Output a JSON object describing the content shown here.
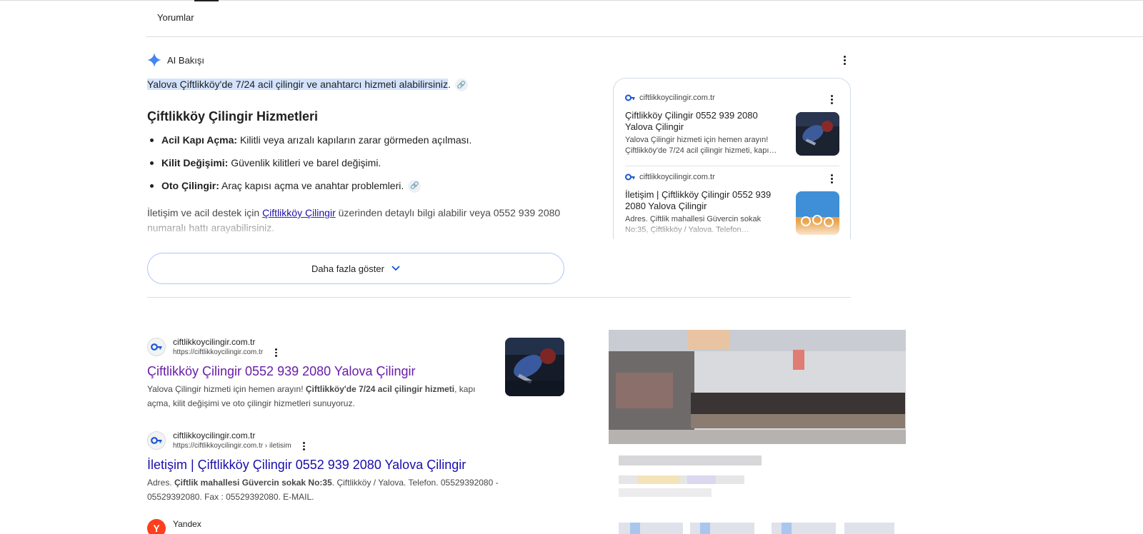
{
  "tabs": {
    "reviews": "Yorumlar"
  },
  "ai_overview": {
    "label": "AI Bakışı",
    "intro": "Yalova Çiftlikköy'de 7/24 acil çilingir ve anahtarcı hizmeti alabilirsiniz",
    "intro_end": ".",
    "heading": "Çiftlikköy Çilingir Hizmetleri",
    "bullets": [
      {
        "bold": "Acil Kapı Açma:",
        "text": " Kilitli veya arızalı kapıların zarar görmeden açılması."
      },
      {
        "bold": "Kilit Değişimi:",
        "text": " Güvenlik kilitleri ve barel değişimi."
      },
      {
        "bold": "Oto Çilingir:",
        "text": " Araç kapısı açma ve anahtar problemleri."
      }
    ],
    "para_before": "İletişim ve acil destek için ",
    "para_link": "Çiftlikköy Çilingir",
    "para_after": " üzerinden detaylı bilgi alabilir veya 0552 939 2080 numaralı hattı arayabilirsiniz.",
    "show_more": "Daha fazla göster",
    "sources": [
      {
        "site": "ciftlikkoycilingir.com.tr",
        "title": "Çiftlikköy Çilingir 0552 939 2080 Yalova Çilingir",
        "snippet": "Yalova Çilingir hizmeti için hemen arayın! Çiftlikköy'de 7/24 acil çilingir hizmeti, kapı…"
      },
      {
        "site": "ciftlikkoycilingir.com.tr",
        "title": "İletişim | Çiftlikköy Çilingir 0552 939 2080 Yalova Çilingir",
        "snippet": "Adres. Çiftlik mahallesi Güvercin sokak No:35, Çiftlikköy / Yalova. Telefon…"
      }
    ]
  },
  "results": [
    {
      "site": "ciftlikkoycilingir.com.tr",
      "url": "https://ciftlikkoycilingir.com.tr",
      "title": "Çiftlikköy Çilingir 0552 939 2080 Yalova Çilingir",
      "snip_a": "Yalova Çilingir hizmeti için hemen arayın! ",
      "snip_bold": "Çiftlikköy'de 7/24 acil çilingir hizmeti",
      "snip_b": ", kapı açma, kilit değişimi ve oto çilingir hizmetleri sunuyoruz."
    },
    {
      "site": "ciftlikkoycilingir.com.tr",
      "url": "https://ciftlikkoycilingir.com.tr › iletisim",
      "title": "İletişim | Çiftlikköy Çilingir 0552 939 2080 Yalova Çilingir",
      "snip_a": "Adres. ",
      "snip_bold": "Çiftlik mahallesi Güvercin sokak No:35",
      "snip_b": ". Çiftlikköy / Yalova. Telefon. 05529392080 - 05529392080. Fax : 05529392080. E-MAIL."
    },
    {
      "site": "Yandex",
      "icon": "Y"
    }
  ],
  "colors": {
    "link_visited": "#681da8",
    "link": "#1a0dab",
    "highlight": "#d3e3fd",
    "ai_star": "#4285f4"
  }
}
